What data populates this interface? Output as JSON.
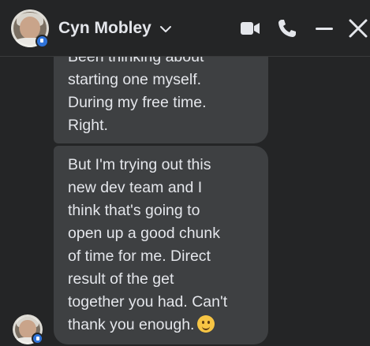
{
  "header": {
    "contact_name": "Cyn Mobley",
    "icons": [
      "chevron-down-icon",
      "video-call-icon",
      "phone-call-icon",
      "minimize-icon",
      "close-icon"
    ]
  },
  "messages": [
    {
      "lines": [
        "Been thinking about",
        "starting one myself.",
        "During my free time.",
        "Right."
      ]
    },
    {
      "lines": [
        "But I'm trying out this",
        "new dev team and I",
        "think that's going to",
        "open up a good chunk",
        "of time for me. Direct",
        "result of the get",
        "together you had. Can't",
        "thank you enough."
      ],
      "emoji": "slightly-smiling-face-emoji"
    }
  ],
  "colors": {
    "background": "#242526",
    "bubble": "#3e4042",
    "text": "#e4e6eb",
    "accent": "#2f73d9"
  }
}
